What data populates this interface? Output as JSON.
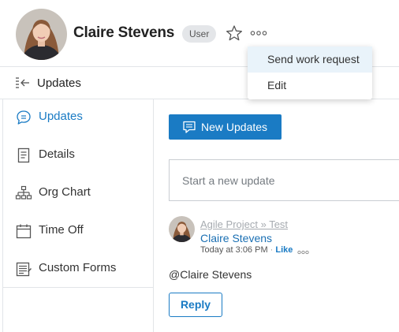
{
  "profile": {
    "name": "Claire Stevens",
    "role_badge": "User"
  },
  "profile_menu": {
    "items": [
      {
        "label": "Send work request",
        "highlighted": true
      },
      {
        "label": "Edit",
        "highlighted": false
      }
    ]
  },
  "subheader": {
    "title": "Updates"
  },
  "sidebar": {
    "items": [
      {
        "label": "Updates",
        "icon": "chat-bubble-icon",
        "active": true
      },
      {
        "label": "Details",
        "icon": "document-icon",
        "active": false
      },
      {
        "label": "Org Chart",
        "icon": "org-chart-icon",
        "active": false
      },
      {
        "label": "Time Off",
        "icon": "calendar-icon",
        "active": false
      },
      {
        "label": "Custom Forms",
        "icon": "form-icon",
        "active": false
      }
    ]
  },
  "main": {
    "new_updates_label": "New Updates",
    "compose_placeholder": "Start a new update",
    "post": {
      "context": "Agile Project » Test",
      "author": "Claire Stevens",
      "timestamp": "Today at 3:06 PM",
      "separator": "·",
      "like_label": "Like",
      "body": "@Claire Stevens",
      "reply_label": "Reply"
    }
  },
  "colors": {
    "accent": "#1a7bc4",
    "menu_highlight": "#e9f3fa",
    "badge_bg": "#e4e6e9"
  }
}
